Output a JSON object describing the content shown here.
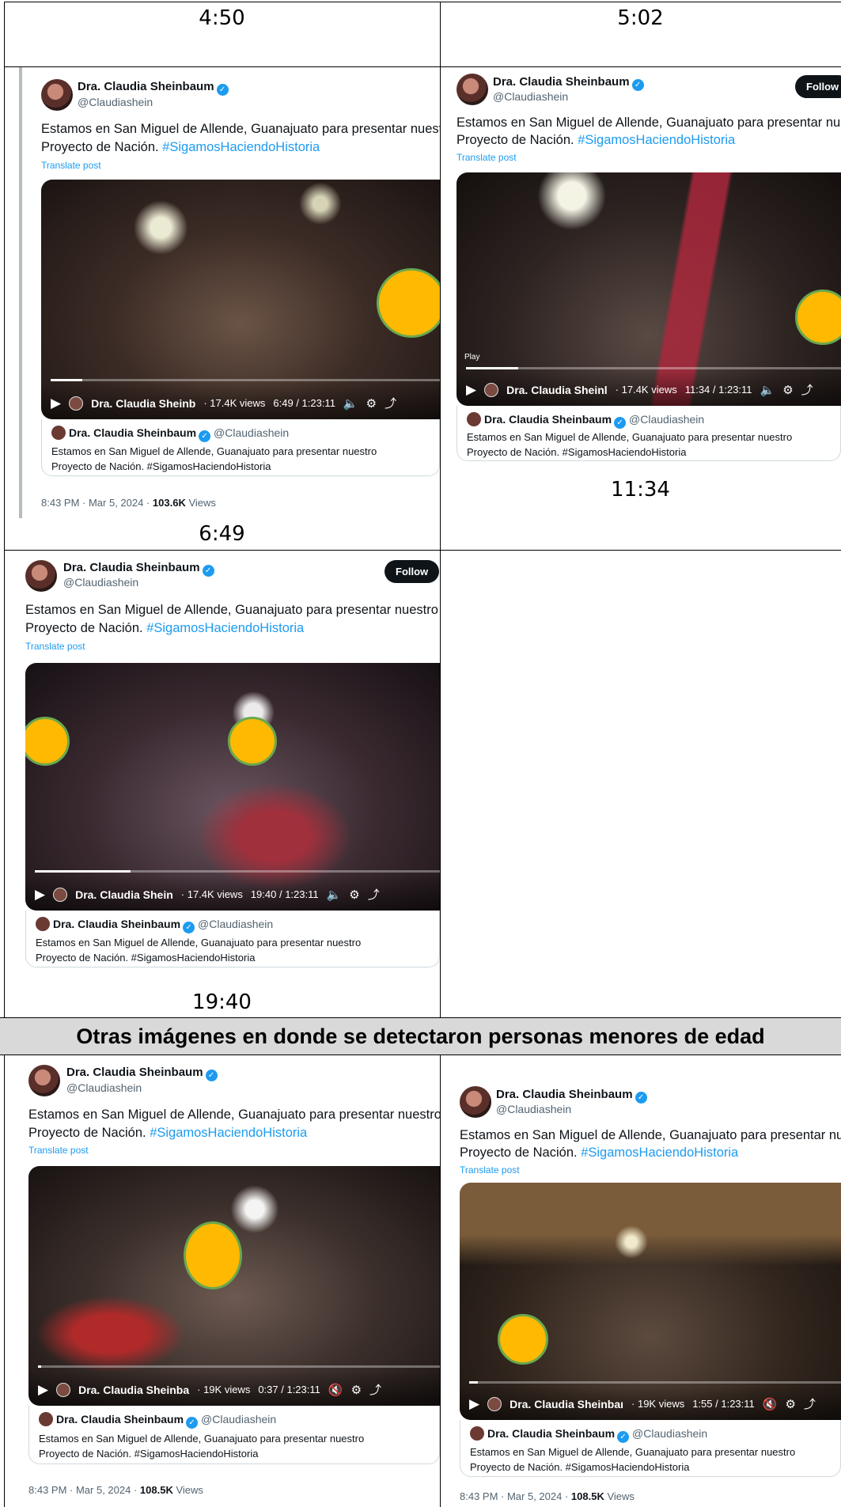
{
  "timestamps": {
    "header_left": "4:50",
    "header_right": "5:02",
    "under_post1": "6:49",
    "under_post2": "11:34",
    "under_post3": "19:40"
  },
  "section_title": "Otras imágenes en donde se detectaron personas menores de edad",
  "post": {
    "name": "Dra. Claudia Sheinbaum",
    "handle": "@Claudiashein",
    "follow": "Follow",
    "text_line1": "Estamos en San Miguel de Allende, Guanajuato para presentar nuestro",
    "text_line2_prefix": "Proyecto de Nación.",
    "hashtag": "#SigamosHaciendoHistoria",
    "translate": "Translate post",
    "quote_line1": "Estamos en San Miguel de Allende, Guanajuato para presentar nuestro",
    "quote_line2": "Proyecto de Nación. #SigamosHaciendoHistoria",
    "play": "Play"
  },
  "posts": [
    {
      "video_name": "Dra. Claudia Sheinb",
      "views": "17.4K views",
      "time": "6:49 / 1:23:11",
      "meta_date": "8:43 PM · Mar 5, 2024 · ",
      "meta_views": "103.6K",
      "meta_label": "Views",
      "progress": 0.082
    },
    {
      "video_name": "Dra. Claudia Sheinl",
      "views": "17.4K views",
      "time": "11:34 / 1:23:11",
      "progress": 0.139
    },
    {
      "video_name": "Dra. Claudia Shein",
      "views": "17.4K views",
      "time": "19:40 / 1:23:11",
      "progress": 0.236
    },
    {
      "video_name": "Dra. Claudia Sheinba",
      "views": "19K views",
      "time": "0:37 / 1:23:11",
      "meta_date": "8:43 PM · Mar 5, 2024 · ",
      "meta_views": "108.5K",
      "meta_label": "Views",
      "progress": 0.007
    },
    {
      "video_name": "Dra. Claudia Sheinbaı",
      "views": "19K views",
      "time": "1:55 / 1:23:11",
      "meta_date": "8:43 PM · Mar 5, 2024 · ",
      "meta_views": "108.5K",
      "meta_label": "Views",
      "progress": 0.023
    }
  ],
  "icons": {
    "play": "play-icon",
    "volume": "volume-icon",
    "settings": "settings-icon",
    "share": "share-icon",
    "verified": "verified-badge-icon"
  }
}
